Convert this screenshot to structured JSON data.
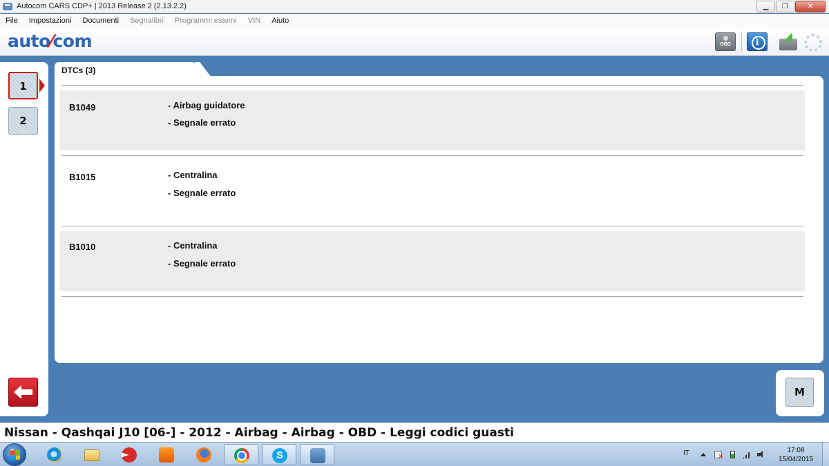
{
  "window": {
    "title": "Autocom CARS CDP+ | 2013 Release 2 (2.13.2.2)",
    "buttons": {
      "minimize": "▁",
      "restore": "❐",
      "close": "✕"
    }
  },
  "menu": {
    "items": [
      {
        "label": "File",
        "enabled": true
      },
      {
        "label": "Impostazioni",
        "enabled": true
      },
      {
        "label": "Documenti",
        "enabled": true
      },
      {
        "label": "Segnalibri",
        "enabled": false
      },
      {
        "label": "Programmi esterni",
        "enabled": false
      },
      {
        "label": "VIN",
        "enabled": false
      },
      {
        "label": "Aiuto",
        "enabled": true
      }
    ]
  },
  "header": {
    "logo_left": "auto",
    "logo_dash": "⁄",
    "logo_right": "com",
    "obd_label": "OBD",
    "icons": [
      "obd-icon",
      "info-icon",
      "battery-charge-icon",
      "busy-spinner-icon"
    ]
  },
  "steps": {
    "items": [
      {
        "label": "1",
        "active": true
      },
      {
        "label": "2",
        "active": false
      }
    ]
  },
  "tab": {
    "label": "DTCs (3)"
  },
  "dtcs": [
    {
      "code": "B1049",
      "lines": [
        "- Airbag guidatore",
        "- Segnale errato"
      ]
    },
    {
      "code": "B1015",
      "lines": [
        "- Centralina",
        "- Segnale errato"
      ]
    },
    {
      "code": "B1010",
      "lines": [
        "- Centralina",
        "- Segnale errato"
      ]
    }
  ],
  "right_panel": {
    "m_label": "M"
  },
  "status": {
    "text": "Nissan - Qashqai J10 [06-] - 2012 - Airbag - Airbag - OBD - Leggi codici guasti"
  },
  "taskbar": {
    "apps": [
      "start-orb",
      "internet-explorer",
      "file-explorer",
      "ccleaner",
      "media-player",
      "firefox",
      "chrome",
      "skype",
      "autocom"
    ],
    "language": "IT",
    "time": "17:08",
    "date": "15/04/2015"
  },
  "colors": {
    "background": "#4a7fb5",
    "accent_red": "#c71d1d",
    "logo_blue": "#2e66b3",
    "row_shade": "#ececec"
  }
}
